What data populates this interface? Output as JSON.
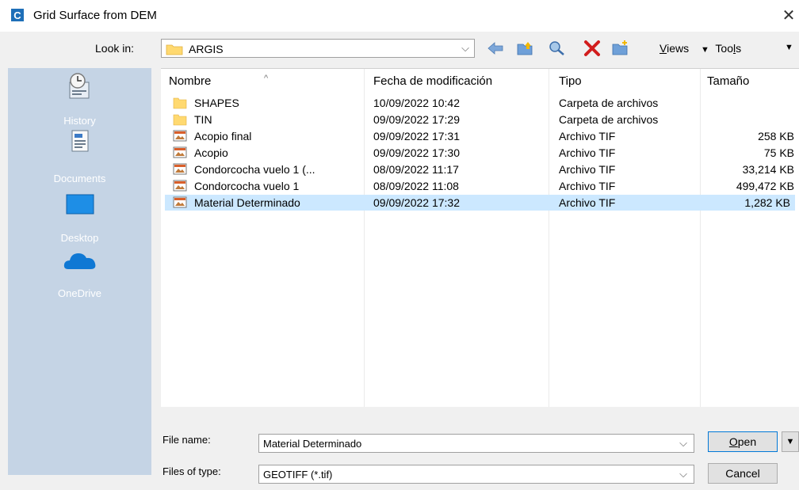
{
  "window": {
    "title": "Grid Surface from DEM",
    "app_icon": "civil3d-c-icon",
    "close_icon": "close-icon"
  },
  "toolbar": {
    "lookin_label": "Look in:",
    "lookin_value": "ARGIS",
    "views_label_rest": "iews",
    "views_label_u": "V",
    "tools_label_pre": "Too",
    "tools_label_u": "l",
    "tools_label_post": "s",
    "icons": [
      "back-arrow-icon",
      "up-folder-icon",
      "search-web-icon",
      "delete-icon",
      "new-folder-icon",
      "views-dropdown-icon",
      "tools-dropdown-icon"
    ]
  },
  "places": [
    {
      "label": "History",
      "icon": "history-icon"
    },
    {
      "label": "Documents",
      "icon": "documents-icon"
    },
    {
      "label": "Desktop",
      "icon": "desktop-icon"
    },
    {
      "label": "OneDrive",
      "icon": "onedrive-icon"
    }
  ],
  "list": {
    "columns": [
      "Nombre",
      "Fecha de modificación",
      "Tipo",
      "Tamaño"
    ],
    "rows": [
      {
        "name": "SHAPES",
        "date": "10/09/2022 10:42",
        "type": "Carpeta de archivos",
        "size": "",
        "icon": "folder-icon",
        "selected": false
      },
      {
        "name": "TIN",
        "date": "09/09/2022 17:29",
        "type": "Carpeta de archivos",
        "size": "",
        "icon": "folder-icon",
        "selected": false
      },
      {
        "name": "Acopio final",
        "date": "09/09/2022 17:31",
        "type": "Archivo TIF",
        "size": "258 KB",
        "icon": "image-file-icon",
        "selected": false
      },
      {
        "name": "Acopio",
        "date": "09/09/2022 17:30",
        "type": "Archivo TIF",
        "size": "75 KB",
        "icon": "image-file-icon",
        "selected": false
      },
      {
        "name": "Condorcocha vuelo 1 (...",
        "date": "08/09/2022 11:17",
        "type": "Archivo TIF",
        "size": "33,214 KB",
        "icon": "image-file-icon",
        "selected": false
      },
      {
        "name": "Condorcocha vuelo 1",
        "date": "08/09/2022 11:08",
        "type": "Archivo TIF",
        "size": "499,472 KB",
        "icon": "image-file-icon",
        "selected": false
      },
      {
        "name": "Material Determinado",
        "date": "09/09/2022 17:32",
        "type": "Archivo TIF",
        "size": "1,282 KB",
        "icon": "image-file-icon",
        "selected": true
      }
    ]
  },
  "fields": {
    "file_name_label": "File name:",
    "file_name_value": "Material Determinado",
    "file_type_label": "Files of type:",
    "file_type_value": "GEOTIFF (*.tif)"
  },
  "buttons": {
    "open_u": "O",
    "open_rest": "pen",
    "cancel": "Cancel"
  },
  "colors": {
    "places_bg": "#c5d4e5",
    "selection": "#cce8ff",
    "dialog_bg": "#f0f0f0"
  }
}
